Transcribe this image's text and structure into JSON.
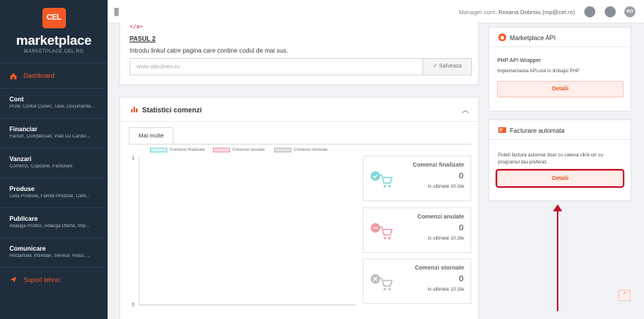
{
  "sidebar": {
    "logo_badge": "CEL",
    "logo_text": "marketplace",
    "logo_sub": "MARKETPLACE.CEL.RO",
    "dashboard": "Dashboard",
    "items": [
      {
        "title": "Cont",
        "sub": "Profil, Contul Curieri, Taxe, Documente..."
      },
      {
        "title": "Financiar",
        "sub": "Facturi, Compensari, Plati Cu Cardul..."
      },
      {
        "title": "Vanzari",
        "sub": "Comenzi, Cupoane, Facturare"
      },
      {
        "title": "Produse",
        "sub": "Lista Produse, Familii Produse, Cam..."
      },
      {
        "title": "Publicare",
        "sub": "Adauga Produs, Adauga Oferta, Imp..."
      },
      {
        "title": "Comunicare",
        "sub": "Reclamatii, Intrebari, Service, Retur, ..."
      }
    ],
    "support": "Suport tehnic"
  },
  "topbar": {
    "hamburger": "|||",
    "manager_prefix": "Manager cont: ",
    "manager_name": "Roxana Dobroiu (mp@cel.ro)",
    "avatar": "RO"
  },
  "pasul": {
    "code": "</a>",
    "title": "PASUL 2",
    "desc": "Introdu linkul catre pagina care contine codul de mai sus.",
    "placeholder": "www.siteulmeu.ro",
    "save": "✓ Salveaza"
  },
  "stats": {
    "title": "Statistici comenzi",
    "tab": "Mai multe",
    "boxes": [
      {
        "name": "Comenzi finalizate",
        "value": "0",
        "sub": "in ultimele 10 zile",
        "color": "#7fd8d8"
      },
      {
        "name": "Comenzi anulate",
        "value": "0",
        "sub": "in ultimele 10 zile",
        "color": "#f29bab"
      },
      {
        "name": "Comenzi stornate",
        "value": "0",
        "sub": "in ultimele 10 zile",
        "color": "#bdbdbd"
      }
    ]
  },
  "chart_data": {
    "type": "line",
    "series": [
      {
        "name": "Comenzi finalizate",
        "color": "#7fd8d8",
        "values": []
      },
      {
        "name": "Comenzi anulate",
        "color": "#f29bab",
        "values": []
      },
      {
        "name": "Comenzi stornate",
        "color": "#c8c8c8",
        "values": []
      }
    ],
    "ylim": [
      0,
      1
    ],
    "y_ticks": [
      "1",
      "0"
    ],
    "legend": "top"
  },
  "right": {
    "api_title": "Marketplace API",
    "api_sub": "PHP API Wrapper",
    "api_desc": "Implementarea API-ului in limbajul PHP",
    "detalii": "Detalii",
    "fact_title": "Facturare automata",
    "fact_desc": "Puteti factura automat doar cu cateva click-uri cu programul tau preferat.",
    "scroll_top": "⌃"
  }
}
